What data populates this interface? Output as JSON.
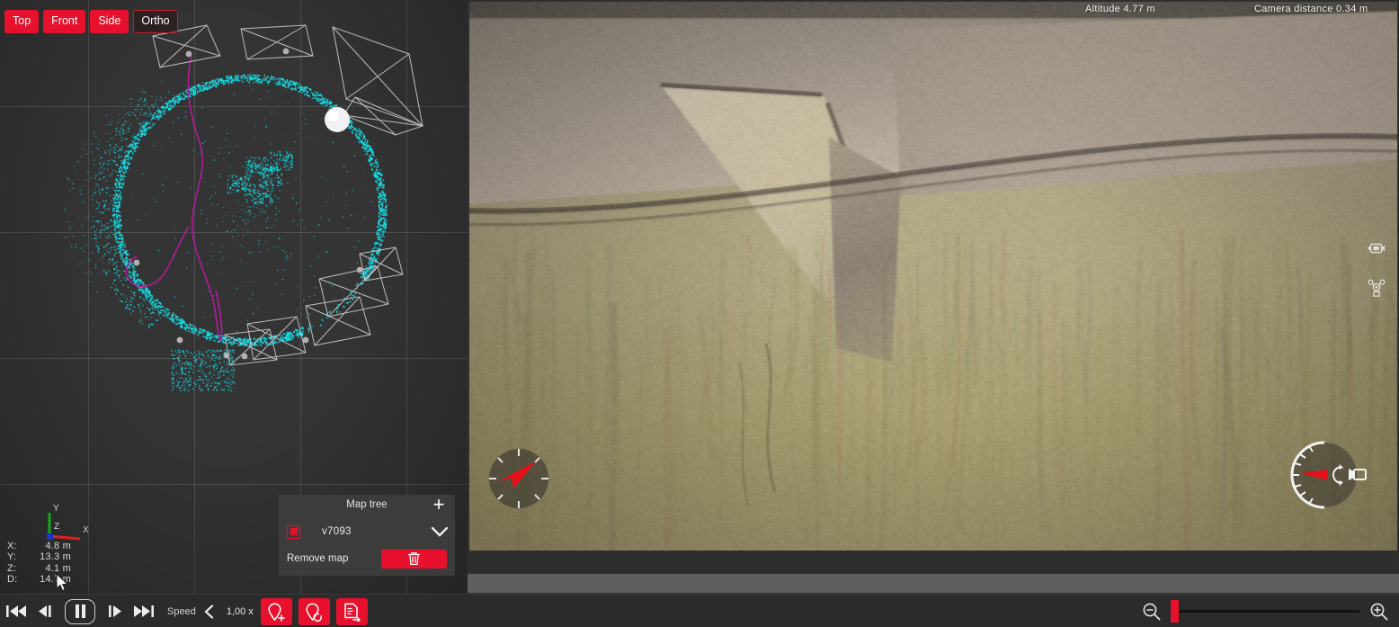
{
  "viewport": {
    "view_buttons": [
      {
        "label": "Top",
        "style": "filled"
      },
      {
        "label": "Front",
        "style": "filled"
      },
      {
        "label": "Side",
        "style": "filled"
      },
      {
        "label": "Ortho",
        "style": "outline"
      }
    ],
    "axis_gizmo": {
      "x_label": "X",
      "y_label": "Y",
      "z_label": "Z",
      "x_color": "#e02020",
      "y_color": "#17a81a",
      "z_color": "#1a34c8"
    },
    "coordinates": [
      {
        "key": "X:",
        "value": "4.8 m"
      },
      {
        "key": "Y:",
        "value": "13.3 m"
      },
      {
        "key": "Z:",
        "value": "4.1 m"
      },
      {
        "key": "D:",
        "value": "14.7 m"
      }
    ],
    "cloud_color": "#16e6f0",
    "trajectory_color": "#b81a9e"
  },
  "map_tree": {
    "title": "Map tree",
    "add_icon": "plus-icon",
    "items": [
      {
        "name": "v7093",
        "checked": true
      }
    ],
    "remove_label": "Remove map",
    "trash_icon": "trash-icon",
    "chevron_icon": "chevron-down-icon"
  },
  "video": {
    "altitude": "Altitude 4.77 m",
    "camera_distance": "Camera distance 0.34 m",
    "side_icons": [
      "video-camera-icon",
      "drone-icon"
    ],
    "compass": {
      "name": "compass-indicator",
      "heading_deg": 38
    },
    "gimbal": {
      "name": "gimbal-pitch-indicator",
      "pitch_deg": -8
    }
  },
  "playback": {
    "skip_start_icon": "skip-to-start-icon",
    "step_back_icon": "step-backward-icon",
    "pause_icon": "pause-icon",
    "step_forward_icon": "step-forward-icon",
    "skip_end_icon": "skip-to-end-icon",
    "speed_label": "Speed",
    "speed_value": "1,00 x",
    "prev_icon": "chevron-left-icon",
    "next_icon": "chevron-right-icon",
    "actions": [
      {
        "name": "add-waypoint-button",
        "icon": "map-pin-plus-icon"
      },
      {
        "name": "reset-waypoint-button",
        "icon": "map-pin-refresh-icon"
      },
      {
        "name": "export-report-button",
        "icon": "document-export-icon"
      }
    ]
  },
  "zoom_control": {
    "minus_icon": "zoom-out-icon",
    "plus_icon": "zoom-in-icon",
    "value_percent": 0
  },
  "theme": {
    "accent": "#e8112d",
    "panel": "#3c3c3c",
    "background": "#2b2b2b"
  }
}
